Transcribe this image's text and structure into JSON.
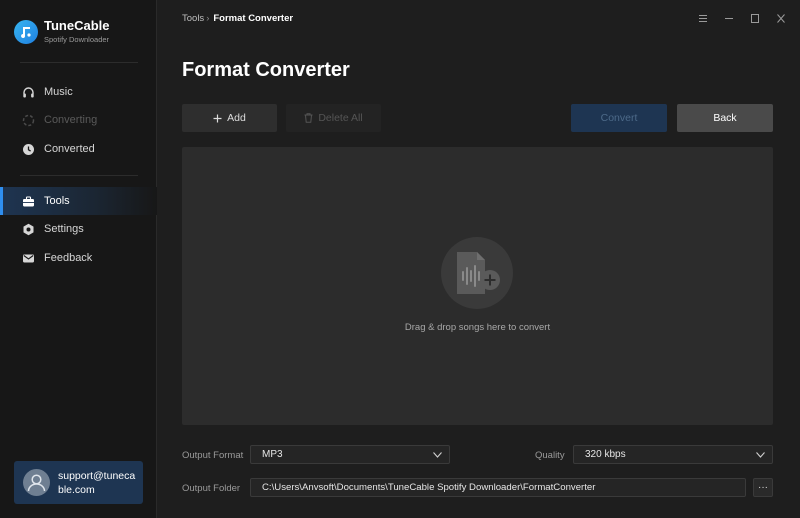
{
  "app": {
    "name": "TuneCable",
    "subtitle": "Spotify Downloader"
  },
  "sidebar": {
    "items": [
      {
        "label": "Music",
        "icon": "headphones-icon"
      },
      {
        "label": "Converting",
        "icon": "spinner-icon"
      },
      {
        "label": "Converted",
        "icon": "clock-icon"
      },
      {
        "label": "Tools",
        "icon": "toolbox-icon"
      },
      {
        "label": "Settings",
        "icon": "gear-icon"
      },
      {
        "label": "Feedback",
        "icon": "mail-icon"
      }
    ],
    "account_email": "support@tunecable.com"
  },
  "breadcrumb": {
    "parent": "Tools",
    "current": "Format Converter"
  },
  "page": {
    "title": "Format Converter"
  },
  "toolbar": {
    "add_label": "Add",
    "delete_all_label": "Delete All",
    "convert_label": "Convert",
    "back_label": "Back"
  },
  "dropzone": {
    "text": "Drag & drop songs here to convert"
  },
  "settings": {
    "output_format_label": "Output Format",
    "output_format_value": "MP3",
    "quality_label": "Quality",
    "quality_value": "320 kbps",
    "output_folder_label": "Output Folder",
    "output_folder_value": "C:\\Users\\Anvsoft\\Documents\\TuneCable Spotify Downloader\\FormatConverter",
    "browse_label": "···"
  },
  "colors": {
    "accent": "#2f8ff0",
    "active_bg": "#1e3552",
    "sidebar_bg": "#171717",
    "main_bg": "#1e1e1e"
  }
}
